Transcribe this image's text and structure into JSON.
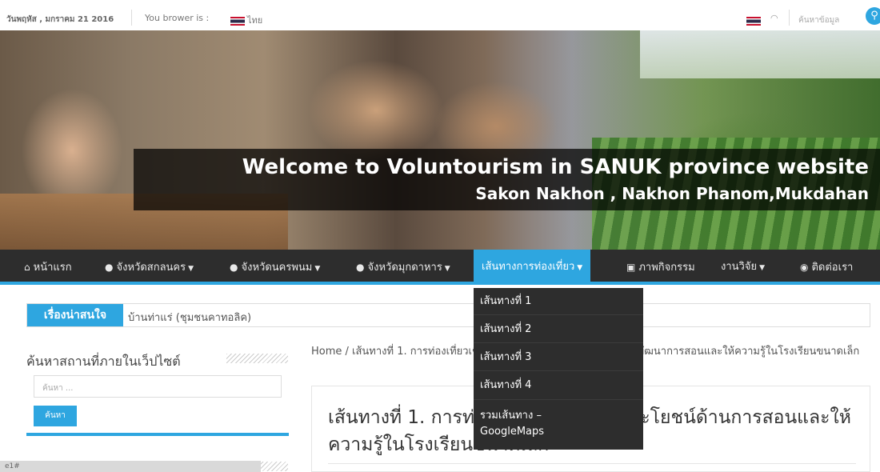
{
  "topbar": {
    "date": "วันพฤหัส , มกราคม 21 2016",
    "browser_label": "You brower is :",
    "language": "ไทย",
    "search_placeholder": "ค้นหาข้อมูล",
    "search_icon": "search-icon",
    "rss_icon": "rss-icon"
  },
  "banner": {
    "title": "Welcome to Voluntourism in SANUK province website",
    "subtitle": "Sakon Nakhon , Nakhon Phanom,Mukdahan"
  },
  "nav": {
    "items": [
      {
        "label": "หน้าแรก",
        "icon": "home-icon"
      },
      {
        "label": "จังหวัดสกลนคร",
        "icon": "map-marker-icon"
      },
      {
        "label": "จังหวัดนครพนม",
        "icon": "map-marker-icon"
      },
      {
        "label": "จังหวัดมุกดาหาร",
        "icon": "map-marker-icon"
      },
      {
        "label": "เส้นทางการท่องเที่ยว"
      },
      {
        "label": "ภาพกิจกรรม",
        "icon": "image-icon"
      },
      {
        "label": "งานวิจัย"
      },
      {
        "label": "ติดต่อเรา",
        "icon": "comments-icon"
      }
    ],
    "accent": "#2ea6e0",
    "background": "#2d2d2d"
  },
  "dropdown": {
    "items": [
      "เส้นทางที่ 1",
      "เส้นทางที่ 2",
      "เส้นทางที่ 3",
      "เส้นทางที่ 4",
      "รวมเส้นทาง – GoogleMaps"
    ]
  },
  "ticker": {
    "label": "เรื่องน่าสนใจ",
    "text": "บ้านท่าแร่ (ชุมชนคาทอลิค)"
  },
  "sidebar": {
    "title": "ค้นหาสถานที่ภายในเว็ปไซต์",
    "search_placeholder": "ค้นหา ...",
    "search_button": "ค้นหา"
  },
  "breadcrumb": {
    "text": "Home / เส้นทางที่ 1. การท่องเที่ยวเชิงอาสาสมัครเพื่อพัฒนาโรงเรียนและพัฒนาการสอนและให้ความรู้ในโรงเรียนขนาดเล็ก"
  },
  "post": {
    "title": "เส้นทางที่ 1. การท่องเที่ยวเพื่อเพิ่มพูนประโยชน์ด้านการสอนและให้ความรู้ในโรงเรียนขนาดเล็ก"
  },
  "status_bar": {
    "text": "e1#"
  }
}
